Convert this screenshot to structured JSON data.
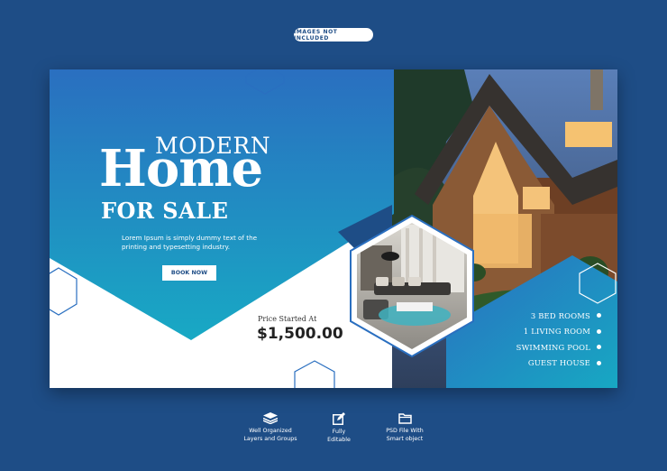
{
  "top_badge": "IMAGES NOT INCLUDED",
  "banner": {
    "title_line1": "MODERN",
    "title_line2": "Home",
    "title_line3": "FOR SALE",
    "description": "Lorem Ipsum is simply dummy text of the printing and typesetting industry.",
    "cta_label": "BOOK NOW",
    "price_label": "Price Started At",
    "price_value": "$1,500.00",
    "features": [
      "3 BED ROOMS",
      "1 LIVING ROOM",
      "SWIMMING POOL",
      "GUEST HOUSE"
    ],
    "colors": {
      "blue": "#2a6fc0",
      "teal": "#17a8c3",
      "dark_blue": "#1e4d86"
    }
  },
  "bottom_features": [
    {
      "icon": "layers-icon",
      "line1": "Well Organized",
      "line2": "Layers and Groups"
    },
    {
      "icon": "edit-icon",
      "line1": "Fully",
      "line2": "Editable"
    },
    {
      "icon": "folder-icon",
      "line1": "PSD File With",
      "line2": "Smart object"
    }
  ]
}
